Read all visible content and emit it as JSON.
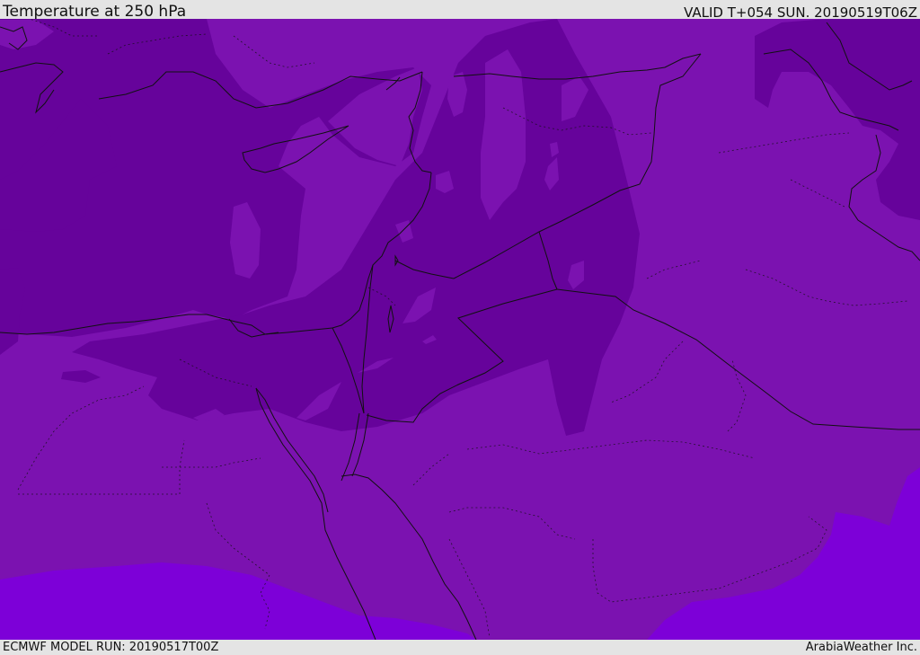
{
  "header": {
    "title": "Temperature at 250 hPa",
    "valid": "VALID T+054 SUN. 20190519T06Z"
  },
  "footer": {
    "model_run": "ECMWF MODEL RUN: 20190517T00Z",
    "brand": "ArabiaWeather Inc."
  },
  "map": {
    "colors": {
      "band_mid": "#7b12b0",
      "band_dark": "#66039b",
      "band_light": "#7d00d8",
      "coast": "#111111"
    }
  }
}
